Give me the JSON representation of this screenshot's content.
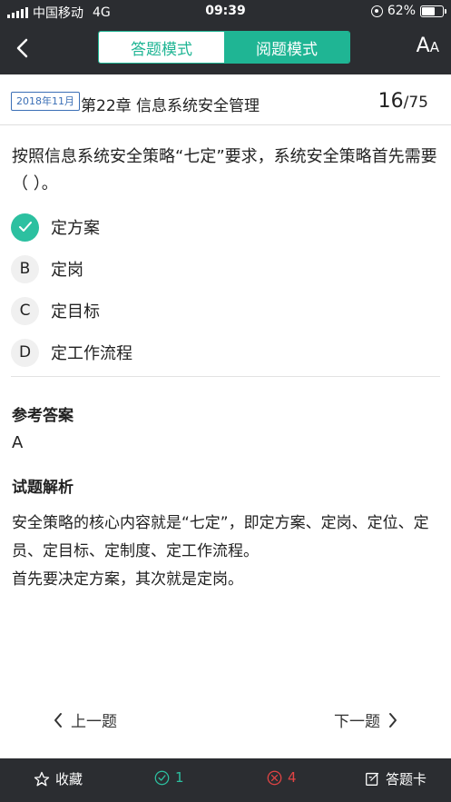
{
  "status_bar": {
    "carrier": "中国移动",
    "network": "4G",
    "time": "09:39",
    "battery_text": "62%",
    "battery_level": 0.62
  },
  "nav": {
    "tabs": [
      {
        "label": "答题模式",
        "active": false
      },
      {
        "label": "阅题模式",
        "active": true
      }
    ],
    "font_size_big": "A",
    "font_size_small": "A"
  },
  "chapter": {
    "date_badge": "2018年11月",
    "title": "第22章 信息系统安全管理",
    "current": "16",
    "total": "/75"
  },
  "question": {
    "text": "按照信息系统安全策略“七定”要求，系统安全策略首先需要（ ）。",
    "options": [
      {
        "key": "A",
        "text": "定方案",
        "correct": true
      },
      {
        "key": "B",
        "text": "定岗",
        "correct": false
      },
      {
        "key": "C",
        "text": "定目标",
        "correct": false
      },
      {
        "key": "D",
        "text": "定工作流程",
        "correct": false
      }
    ]
  },
  "reference": {
    "title": "参考答案",
    "value": "A"
  },
  "analysis": {
    "title": "试题解析",
    "paragraphs": [
      "安全策略的核心内容就是“七定”，即定方案、定岗、定位、定员、定目标、定制度、定工作流程。",
      "首先要决定方案，其次就是定岗。"
    ]
  },
  "pager": {
    "prev": "上一题",
    "next": "下一题"
  },
  "bottom_bar": {
    "favorite": "收藏",
    "correct_count": "1",
    "wrong_count": "4",
    "answer_card": "答题卡"
  },
  "colors": {
    "accent": "#1fb594",
    "dark_bar": "#2b2d31",
    "wrong": "#e24444",
    "badge_blue": "#3b6fb6"
  }
}
